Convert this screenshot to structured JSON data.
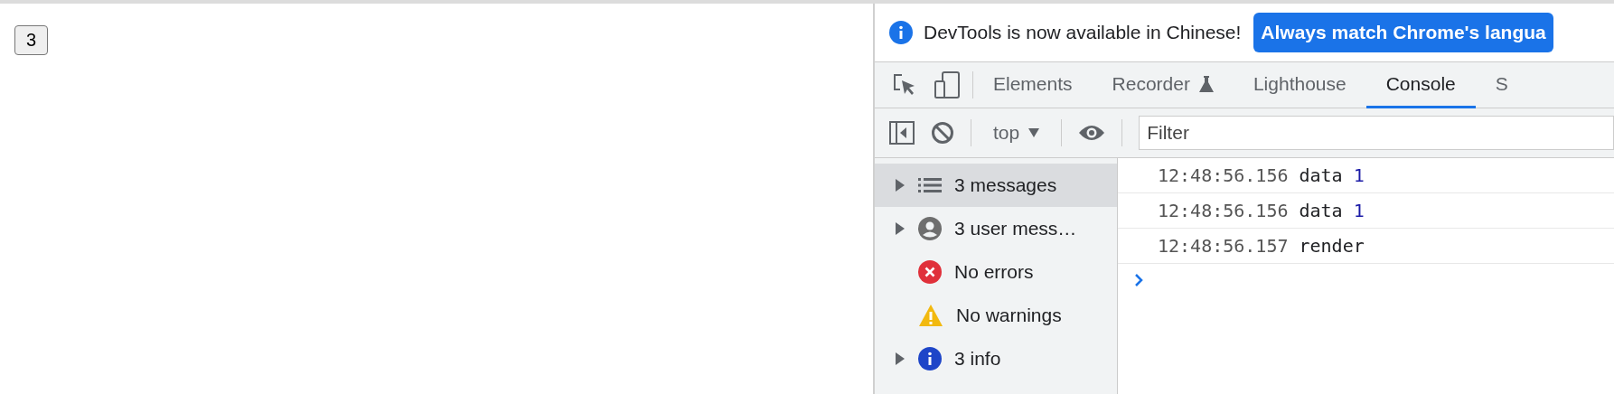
{
  "page": {
    "button": "3"
  },
  "devtools": {
    "banner": {
      "message": "DevTools is now available in Chinese!",
      "action": "Always match Chrome's langua"
    },
    "tabs": [
      {
        "label": "Elements",
        "selected": false,
        "kind": "plain"
      },
      {
        "label": "Recorder",
        "selected": false,
        "kind": "flask"
      },
      {
        "label": "Lighthouse",
        "selected": false,
        "kind": "plain"
      },
      {
        "label": "Console",
        "selected": true,
        "kind": "plain"
      },
      {
        "label": "S",
        "selected": false,
        "kind": "plain"
      }
    ],
    "toolbar": {
      "context": "top",
      "filter_placeholder": "Filter"
    },
    "sidebar": [
      {
        "label": "3 messages",
        "kind": "list",
        "expandable": true,
        "selected": true
      },
      {
        "label": "3 user mess…",
        "kind": "user",
        "expandable": true,
        "selected": false
      },
      {
        "label": "No errors",
        "kind": "error",
        "expandable": false,
        "selected": false
      },
      {
        "label": "No warnings",
        "kind": "warning",
        "expandable": false,
        "selected": false
      },
      {
        "label": "3 info",
        "kind": "info",
        "expandable": true,
        "selected": false
      }
    ],
    "messages": [
      {
        "time": "12:48:56.156",
        "text": "data",
        "value": "1"
      },
      {
        "time": "12:48:56.156",
        "text": "data",
        "value": "1"
      },
      {
        "time": "12:48:56.157",
        "text": "render"
      }
    ]
  }
}
